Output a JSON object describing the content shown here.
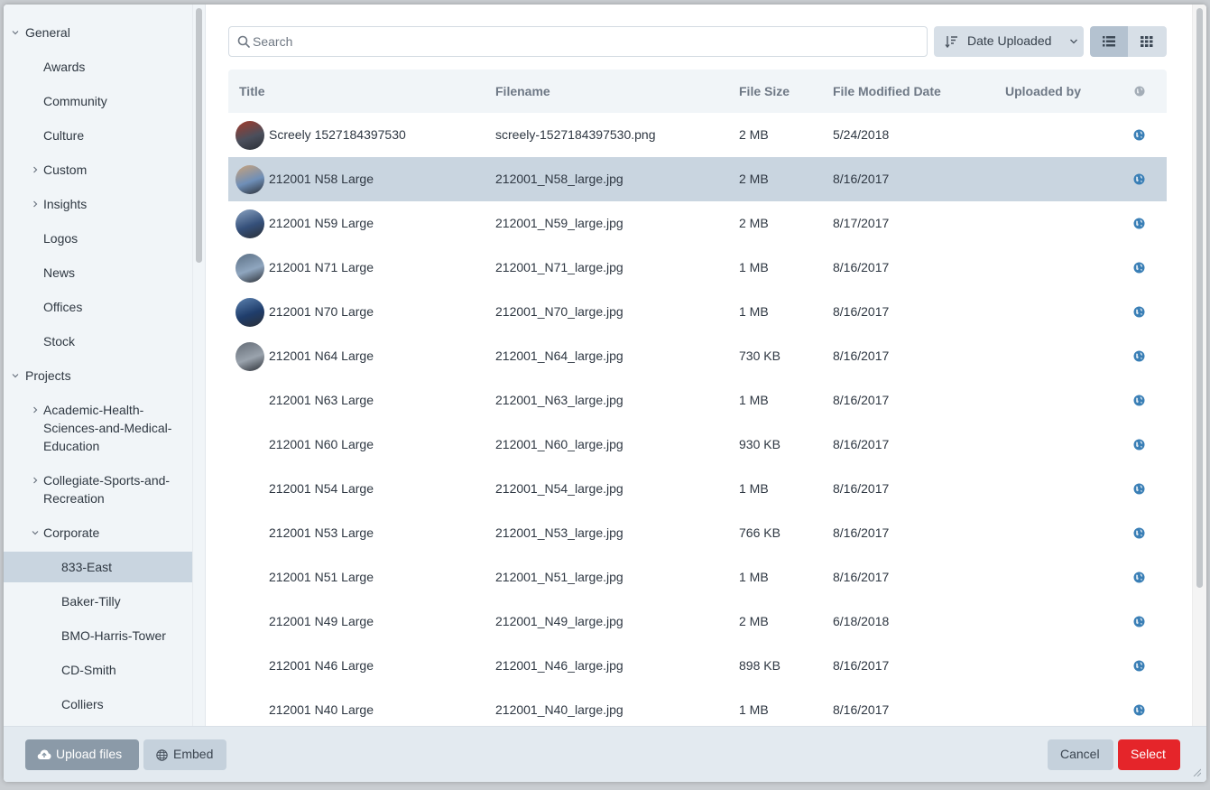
{
  "sidebar": {
    "items": [
      {
        "label": "General",
        "caret": "down"
      },
      {
        "label": "Awards"
      },
      {
        "label": "Community"
      },
      {
        "label": "Culture"
      },
      {
        "label": "Custom",
        "caret": "right"
      },
      {
        "label": "Insights",
        "caret": "right"
      },
      {
        "label": "Logos"
      },
      {
        "label": "News"
      },
      {
        "label": "Offices"
      },
      {
        "label": "Stock"
      },
      {
        "label": "Projects",
        "caret": "down"
      },
      {
        "label": "Academic-Health-",
        "caret": "right"
      },
      {
        "label": "Sciences-and-Medical-"
      },
      {
        "label": "Education"
      },
      {
        "label": "Collegiate-Sports-and-",
        "caret": "right"
      },
      {
        "label": "Recreation"
      },
      {
        "label": "Corporate",
        "caret": "down"
      },
      {
        "label": "833-East",
        "selected": true
      },
      {
        "label": "Baker-Tilly"
      },
      {
        "label": "BMO-Harris-Tower"
      },
      {
        "label": "CD-Smith"
      },
      {
        "label": "Colliers"
      }
    ]
  },
  "toolbar": {
    "search_placeholder": "Search",
    "sort_label": "Date Uploaded"
  },
  "table": {
    "headers": {
      "title": "Title",
      "filename": "Filename",
      "size": "File Size",
      "modified": "File Modified Date",
      "uploaded_by": "Uploaded by"
    },
    "rows": [
      {
        "title": "Screely 1527184397530",
        "filename": "screely-1527184397530.png",
        "size": "2 MB",
        "date": "5/24/2018",
        "thumb": true
      },
      {
        "title": "212001 N58 Large",
        "filename": "212001_N58_large.jpg",
        "size": "2 MB",
        "date": "8/16/2017",
        "thumb": true,
        "selected": true
      },
      {
        "title": "212001 N59 Large",
        "filename": "212001_N59_large.jpg",
        "size": "2 MB",
        "date": "8/17/2017",
        "thumb": true
      },
      {
        "title": "212001 N71 Large",
        "filename": "212001_N71_large.jpg",
        "size": "1 MB",
        "date": "8/16/2017",
        "thumb": true
      },
      {
        "title": "212001 N70 Large",
        "filename": "212001_N70_large.jpg",
        "size": "1 MB",
        "date": "8/16/2017",
        "thumb": true
      },
      {
        "title": "212001 N64 Large",
        "filename": "212001_N64_large.jpg",
        "size": "730 KB",
        "date": "8/16/2017",
        "thumb": true
      },
      {
        "title": "212001 N63 Large",
        "filename": "212001_N63_large.jpg",
        "size": "1 MB",
        "date": "8/16/2017"
      },
      {
        "title": "212001 N60 Large",
        "filename": "212001_N60_large.jpg",
        "size": "930 KB",
        "date": "8/16/2017"
      },
      {
        "title": "212001 N54 Large",
        "filename": "212001_N54_large.jpg",
        "size": "1 MB",
        "date": "8/16/2017"
      },
      {
        "title": "212001 N53 Large",
        "filename": "212001_N53_large.jpg",
        "size": "766 KB",
        "date": "8/16/2017"
      },
      {
        "title": "212001 N51 Large",
        "filename": "212001_N51_large.jpg",
        "size": "1 MB",
        "date": "8/16/2017"
      },
      {
        "title": "212001 N49 Large",
        "filename": "212001_N49_large.jpg",
        "size": "2 MB",
        "date": "6/18/2018"
      },
      {
        "title": "212001 N46 Large",
        "filename": "212001_N46_large.jpg",
        "size": "898 KB",
        "date": "8/16/2017"
      },
      {
        "title": "212001 N40 Large",
        "filename": "212001_N40_large.jpg",
        "size": "1 MB",
        "date": "8/16/2017"
      }
    ]
  },
  "footer": {
    "upload_label": "Upload files",
    "embed_label": "Embed",
    "cancel_label": "Cancel",
    "select_label": "Select"
  },
  "colors": {
    "accent": "#e5252a",
    "selection": "#c9d5e0",
    "globe": "#3a7fb6"
  }
}
